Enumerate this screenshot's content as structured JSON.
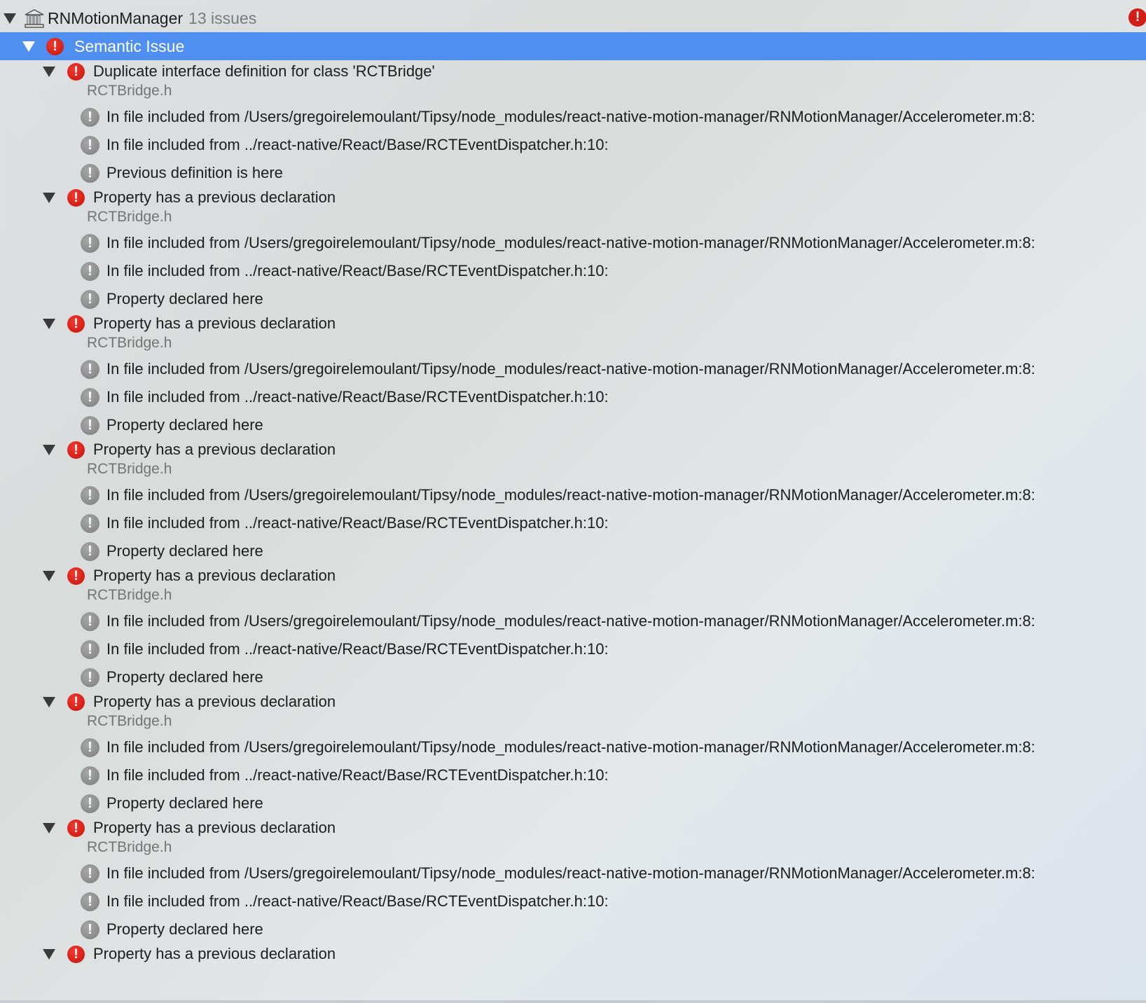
{
  "project": {
    "name": "RNMotionManager",
    "count": "13 issues",
    "icon": "building-icon",
    "badge": "!",
    "badge_color": "#d21f16"
  },
  "group": {
    "label": "Semantic Issue",
    "selected_color": "#4f8ff0"
  },
  "issues": [
    {
      "title": "Duplicate interface definition for class 'RCTBridge'",
      "file": "RCTBridge.h",
      "subs": [
        "In file included from /Users/gregoirelemoulant/Tipsy/node_modules/react-native-motion-manager/RNMotionManager/Accelerometer.m:8:",
        "In file included from ../react-native/React/Base/RCTEventDispatcher.h:10:",
        "Previous definition is here"
      ]
    },
    {
      "title": "Property has a previous declaration",
      "file": "RCTBridge.h",
      "subs": [
        "In file included from /Users/gregoirelemoulant/Tipsy/node_modules/react-native-motion-manager/RNMotionManager/Accelerometer.m:8:",
        "In file included from ../react-native/React/Base/RCTEventDispatcher.h:10:",
        "Property declared here"
      ]
    },
    {
      "title": "Property has a previous declaration",
      "file": "RCTBridge.h",
      "subs": [
        "In file included from /Users/gregoirelemoulant/Tipsy/node_modules/react-native-motion-manager/RNMotionManager/Accelerometer.m:8:",
        "In file included from ../react-native/React/Base/RCTEventDispatcher.h:10:",
        "Property declared here"
      ]
    },
    {
      "title": "Property has a previous declaration",
      "file": "RCTBridge.h",
      "subs": [
        "In file included from /Users/gregoirelemoulant/Tipsy/node_modules/react-native-motion-manager/RNMotionManager/Accelerometer.m:8:",
        "In file included from ../react-native/React/Base/RCTEventDispatcher.h:10:",
        "Property declared here"
      ]
    },
    {
      "title": "Property has a previous declaration",
      "file": "RCTBridge.h",
      "subs": [
        "In file included from /Users/gregoirelemoulant/Tipsy/node_modules/react-native-motion-manager/RNMotionManager/Accelerometer.m:8:",
        "In file included from ../react-native/React/Base/RCTEventDispatcher.h:10:",
        "Property declared here"
      ]
    },
    {
      "title": "Property has a previous declaration",
      "file": "RCTBridge.h",
      "subs": [
        "In file included from /Users/gregoirelemoulant/Tipsy/node_modules/react-native-motion-manager/RNMotionManager/Accelerometer.m:8:",
        "In file included from ../react-native/React/Base/RCTEventDispatcher.h:10:",
        "Property declared here"
      ]
    },
    {
      "title": "Property has a previous declaration",
      "file": "RCTBridge.h",
      "subs": [
        "In file included from /Users/gregoirelemoulant/Tipsy/node_modules/react-native-motion-manager/RNMotionManager/Accelerometer.m:8:",
        "In file included from ../react-native/React/Base/RCTEventDispatcher.h:10:",
        "Property declared here"
      ]
    },
    {
      "title": "Property has a previous declaration",
      "file": "",
      "subs": []
    }
  ]
}
